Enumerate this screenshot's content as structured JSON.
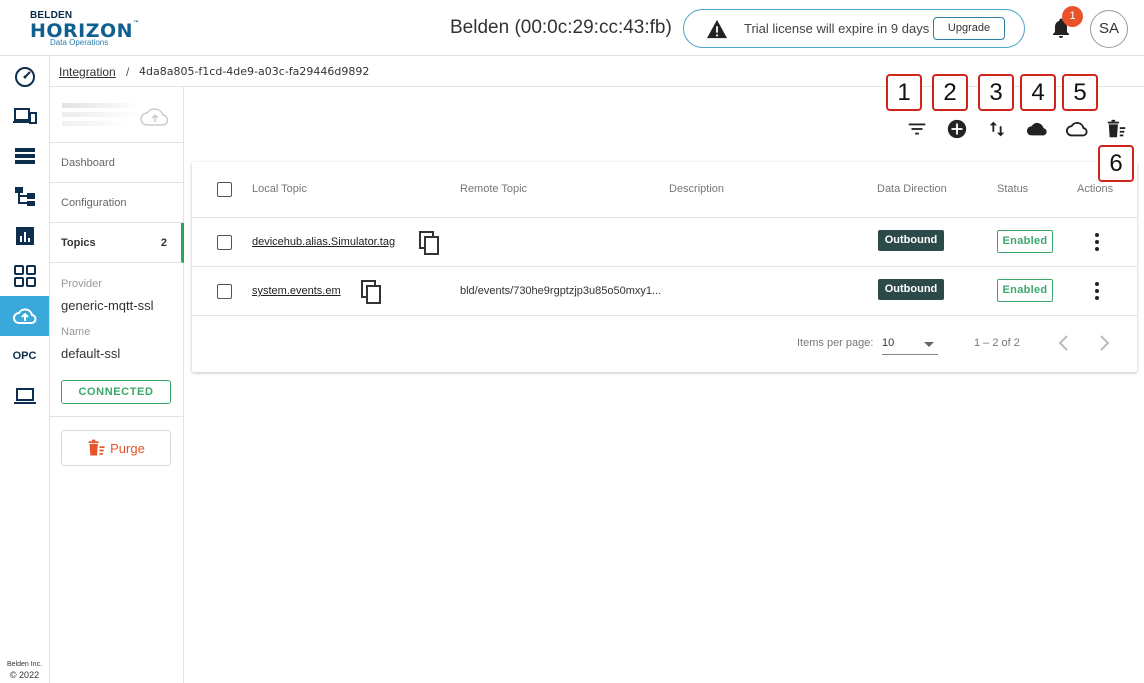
{
  "header": {
    "logo": {
      "line1": "BELDEN",
      "line2": "HORIZON",
      "tm": "™",
      "line3": "Data Operations"
    },
    "device_title": "Belden (00:0c:29:cc:43:fb)",
    "license_message": "Trial license will expire in 9 days",
    "upgrade_label": "Upgrade",
    "notification_count": "1",
    "avatar_initials": "SA"
  },
  "rail": {
    "items": [
      {
        "icon": "speedometer-icon"
      },
      {
        "icon": "devices-icon"
      },
      {
        "icon": "storage-list-icon"
      },
      {
        "icon": "hierarchy-icon"
      },
      {
        "icon": "analytics-icon"
      },
      {
        "icon": "apps-grid-icon"
      },
      {
        "icon": "cloud-upload-icon",
        "active": true
      },
      {
        "icon": "opc-icon",
        "label": "OPC"
      },
      {
        "icon": "laptop-icon"
      }
    ],
    "footer_company": "Belden Inc.",
    "footer_year": "© 2022"
  },
  "breadcrumb": {
    "parent": "Integration",
    "separator": "/",
    "current": "4da8a805-f1cd-4de9-a03c-fa29446d9892"
  },
  "panel": {
    "nav": [
      {
        "label": "Dashboard"
      },
      {
        "label": "Configuration"
      },
      {
        "label": "Topics",
        "count": "2",
        "active": true
      }
    ],
    "provider_label": "Provider",
    "provider_value": "generic-mqtt-ssl",
    "name_label": "Name",
    "name_value": "default-ssl",
    "status": "CONNECTED",
    "purge_label": "Purge"
  },
  "toolbar": {
    "tools": [
      {
        "icon": "filter-icon",
        "callout": "1"
      },
      {
        "icon": "add-circle-icon",
        "callout": "2"
      },
      {
        "icon": "swap-vertical-icon",
        "callout": "3"
      },
      {
        "icon": "cloud-filled-icon",
        "callout": "4"
      },
      {
        "icon": "cloud-outline-icon",
        "callout": "5"
      },
      {
        "icon": "delete-sweep-icon",
        "callout": "6"
      }
    ]
  },
  "table": {
    "columns": [
      "Local Topic",
      "Remote Topic",
      "Description",
      "Data Direction",
      "Status",
      "Actions"
    ],
    "rows": [
      {
        "local_topic": "devicehub.alias.Simulator.tag",
        "remote_topic": "",
        "description": "",
        "direction": "Outbound",
        "status": "Enabled"
      },
      {
        "local_topic": "system.events.em",
        "remote_topic": "bld/events/730he9rgptzjp3u85o50mxy1...",
        "description": "",
        "direction": "Outbound",
        "status": "Enabled"
      }
    ],
    "pagination": {
      "items_per_page_label": "Items per page:",
      "items_per_page": "10",
      "range": "1 – 2 of 2"
    }
  },
  "colors": {
    "accent": "#3aa8d8",
    "success": "#3aa86a",
    "danger": "#e8532b",
    "outbound_badge": "#2d4a4a",
    "callout_border": "#d0241b"
  }
}
